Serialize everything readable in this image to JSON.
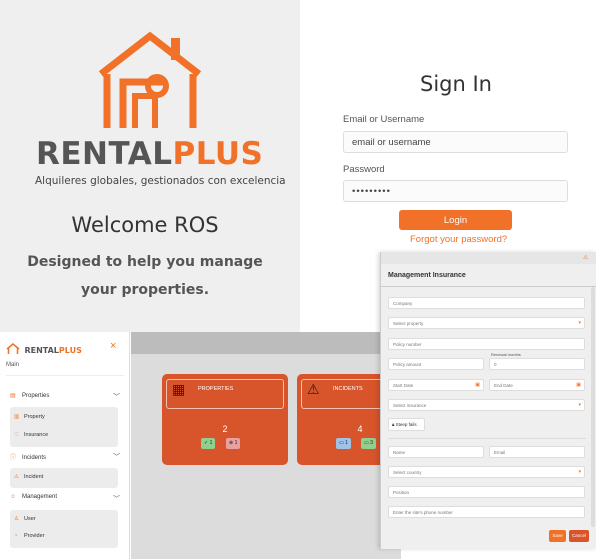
{
  "welcome": {
    "brand_part1": "RENTAL",
    "brand_part2": "PLUS",
    "tagline": "Alquileres globales, gestionados con excelencia",
    "title": "Welcome ROS",
    "subtitle": "Designed to help you manage your properties."
  },
  "signin": {
    "title": "Sign In",
    "email_label": "Email or Username",
    "email_placeholder": "email or username",
    "password_label": "Password",
    "password_value": "•••••••••",
    "login_label": "Login",
    "forgot_label": "Forgot your password?"
  },
  "sidebar": {
    "brand_part1": "RENTAL",
    "brand_part2": "PLUS",
    "close_icon": "×",
    "section": "Main",
    "groups": [
      {
        "label": "Properties",
        "items": [
          "Property",
          "Insurance"
        ]
      },
      {
        "label": "Incidents",
        "items": [
          "Incident"
        ]
      },
      {
        "label": "Management",
        "items": [
          "User",
          "Provider"
        ]
      }
    ]
  },
  "dashboard": {
    "cards": [
      {
        "title": "PROPERTIES",
        "count": "2",
        "chip1": "1",
        "chip2": "1"
      },
      {
        "title": "INCIDENTS",
        "count": "4",
        "chip1": "1",
        "chip2": "3"
      }
    ]
  },
  "modal": {
    "title": "Management Insurance",
    "company": "Company",
    "select_property": "Select property",
    "policy_number": "Policy number",
    "policy_amount": "Policy amount",
    "renewal_label": "Renewal months",
    "renewal_value": "0",
    "start_date": "Start Date",
    "end_date": "End Date",
    "select_insurance": "Select insurance",
    "steps_label": "Steep fails",
    "name": "Name",
    "email": "Email",
    "select_country": "Select country",
    "position": "Position",
    "phone": "Enter the site's phone number",
    "save": "Save",
    "cancel": "Cancel"
  },
  "colors": {
    "accent": "#f07127",
    "card": "#d8542b",
    "grey_text": "#555555"
  }
}
